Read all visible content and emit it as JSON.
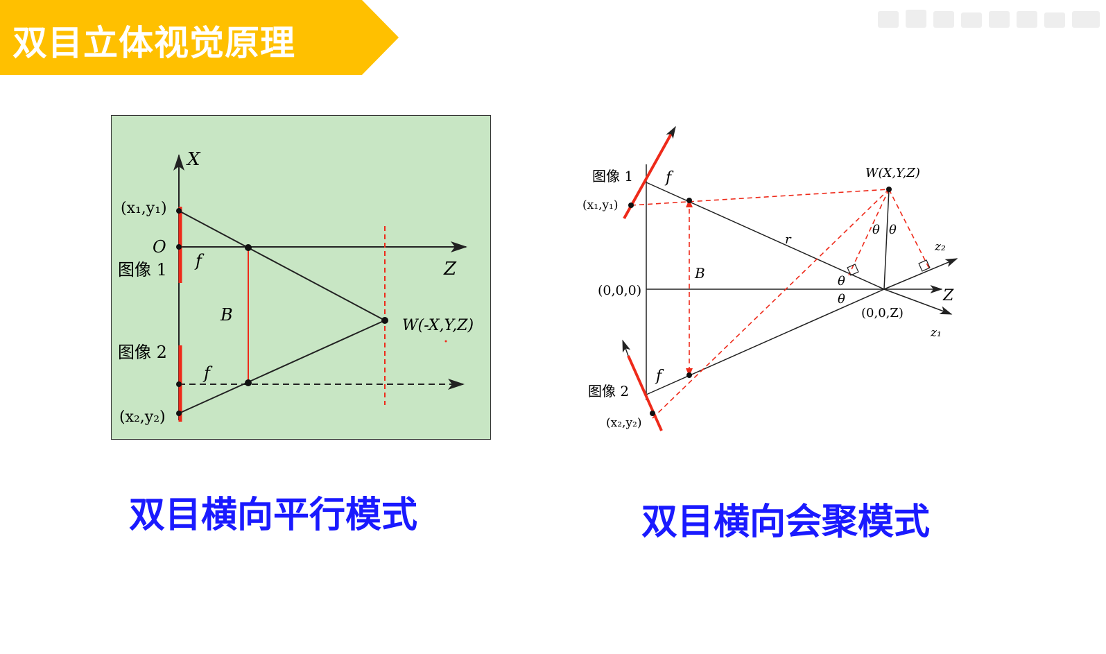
{
  "header": {
    "title": "双目立体视觉原理",
    "accent_color": "#ffc000"
  },
  "left_diagram": {
    "background_color": "#c8e6c4",
    "labels": {
      "x_axis": "X",
      "origin": "O",
      "z_axis": "Z",
      "point1": "(x₁,y₁)",
      "image1": "图像 1",
      "focal1": "f",
      "baseline": "B",
      "image2": "图像 2",
      "focal2": "f",
      "point2": "(x₂,y₂)",
      "world_point": "W(-X,Y,Z)"
    },
    "caption": "双目横向平行模式"
  },
  "right_diagram": {
    "labels": {
      "image1": "图像 1",
      "focal1": "f",
      "point1": "(x₁,y₁)",
      "world_point": "W(X,Y,Z)",
      "theta_a": "θ",
      "theta_b": "θ",
      "r": "r",
      "z2": "z₂",
      "baseline": "B",
      "origin": "(0,0,0)",
      "theta_c": "θ",
      "theta_d": "θ",
      "z_axis": "Z",
      "z_point": "(0,0,Z)",
      "z1": "z₁",
      "focal2": "f",
      "image2": "图像 2",
      "point2": "(x₂,y₂)"
    },
    "caption": "双目横向会聚模式"
  },
  "colors": {
    "red": "#ee2a1a",
    "caption_blue": "#1a1aff"
  }
}
